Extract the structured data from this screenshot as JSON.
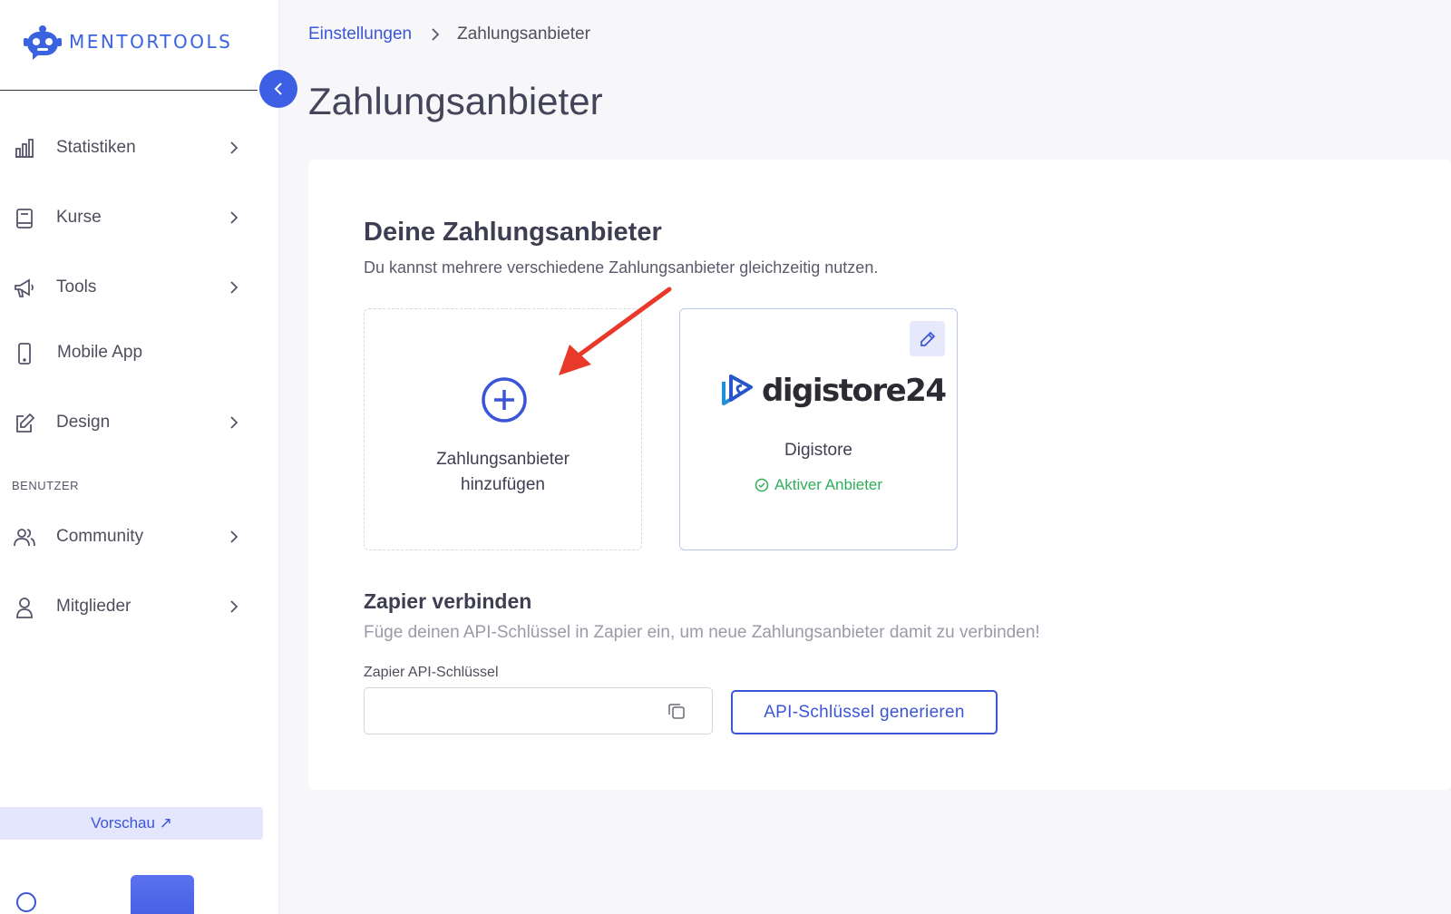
{
  "brand": {
    "name": "MENTORTOOLS",
    "accent": "#3d5fe3"
  },
  "sidebar": {
    "items": [
      {
        "label": "Statistiken",
        "icon": "bar-chart-icon"
      },
      {
        "label": "Kurse",
        "icon": "book-icon"
      },
      {
        "label": "Tools",
        "icon": "megaphone-icon"
      },
      {
        "label": "Mobile App",
        "icon": "smartphone-icon"
      },
      {
        "label": "Design",
        "icon": "pencil-square-icon"
      }
    ],
    "section_label": "BENUTZER",
    "user_items": [
      {
        "label": "Community",
        "icon": "users-icon"
      },
      {
        "label": "Mitglieder",
        "icon": "user-icon"
      }
    ],
    "preview_label": "Vorschau ↗"
  },
  "breadcrumb": {
    "parent": "Einstellungen",
    "current": "Zahlungsanbieter"
  },
  "page": {
    "title": "Zahlungsanbieter"
  },
  "providers": {
    "title": "Deine Zahlungsanbieter",
    "subtitle": "Du kannst mehrere verschiedene Zahlungsanbieter gleichzeitig nutzen.",
    "add_label_line1": "Zahlungsanbieter",
    "add_label_line2": "hinzufügen",
    "items": [
      {
        "logo_text": "digistore24",
        "name": "Digistore",
        "status": "Aktiver Anbieter",
        "status_color": "#2fae5b"
      }
    ]
  },
  "zapier": {
    "title": "Zapier verbinden",
    "subtitle": "Füge deinen API-Schlüssel in Zapier ein, um neue Zahlungsanbieter damit zu verbinden!",
    "field_label": "Zapier API-Schlüssel",
    "field_value": "",
    "generate_label": "API-Schlüssel generieren"
  },
  "annotation": {
    "arrow_color": "#e8392b"
  }
}
